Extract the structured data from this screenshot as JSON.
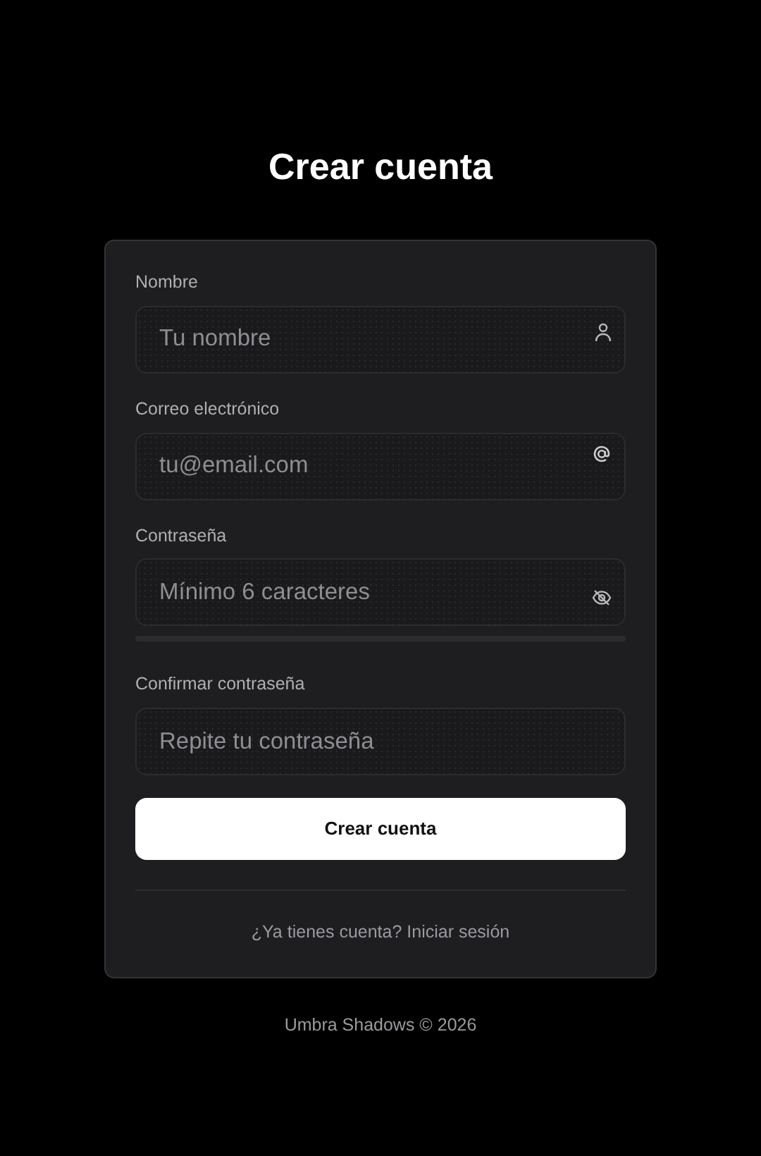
{
  "title": "Crear cuenta",
  "fields": [
    {
      "kind": "text",
      "label": "Nombre",
      "placeholder": "Tu nombre"
    },
    {
      "kind": "email",
      "label": "Correo electrónico",
      "placeholder": "tu@email.com"
    },
    {
      "kind": "password",
      "label": "Contraseña",
      "placeholder": "Mínimo 6 caracteres",
      "strength": {
        "level": 0
      }
    },
    {
      "kind": "confirm",
      "label": "Confirmar contraseña",
      "placeholder": "Repite tu contraseña"
    }
  ],
  "submit": "Crear cuenta",
  "login_prompt": "¿Ya tienes cuenta?",
  "login_link": "Iniciar sesión",
  "footer": "Umbra Shadows © 2026"
}
